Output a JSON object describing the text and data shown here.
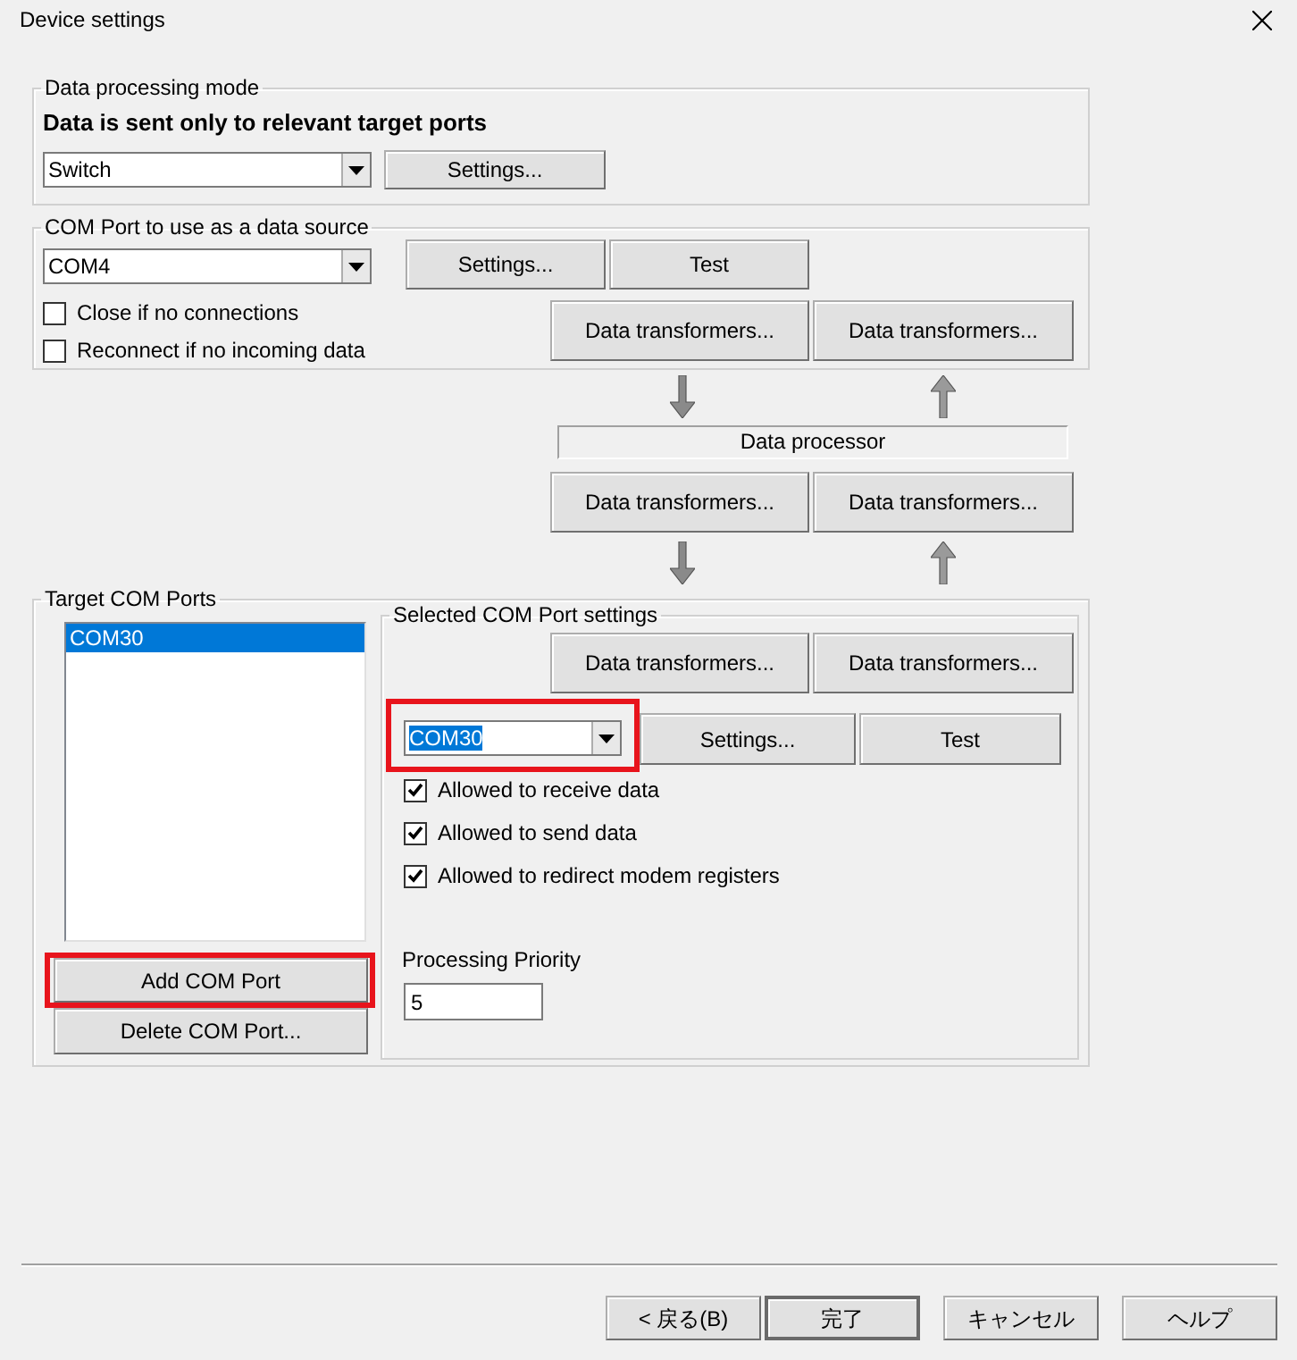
{
  "window": {
    "title": "Device settings"
  },
  "processing_mode": {
    "legend": "Data processing mode",
    "description": "Data is sent only to relevant target ports",
    "mode": {
      "value": "Switch",
      "text_selected": false
    },
    "settings_button": "Settings..."
  },
  "data_source": {
    "legend": "COM Port to use as a data source",
    "port": {
      "value": "COM4",
      "text_selected": false
    },
    "buttons": [
      "Settings...",
      "Test"
    ],
    "options": [
      {
        "label": "Close if no connections",
        "checked": false
      },
      {
        "label": "Reconnect if no incoming data",
        "checked": false
      }
    ],
    "transformer_buttons": [
      "Data transformers...",
      "Data transformers..."
    ]
  },
  "processor": {
    "label": "Data processor",
    "transformer_buttons": [
      "Data transformers...",
      "Data transformers..."
    ]
  },
  "target_ports": {
    "legend": "Target COM Ports",
    "items": [
      {
        "label": "COM30",
        "selected": true
      }
    ],
    "add_button": {
      "label": "Add COM Port",
      "highlighted": true
    },
    "delete_button": {
      "label": "Delete COM Port...",
      "highlighted": false
    }
  },
  "selected_port": {
    "legend": "Selected COM Port settings",
    "transformer_buttons": [
      "Data transformers...",
      "Data transformers..."
    ],
    "port": {
      "value": "COM30",
      "text_selected": true,
      "highlighted": true
    },
    "buttons": [
      "Settings...",
      "Test"
    ],
    "options": [
      {
        "label": "Allowed to receive data",
        "checked": true
      },
      {
        "label": "Allowed to send data",
        "checked": true
      },
      {
        "label": "Allowed to redirect modem registers",
        "checked": true
      }
    ],
    "priority_label": "Processing Priority",
    "priority": "5"
  },
  "footer_buttons": [
    {
      "label": "< 戻る(B)",
      "default": false
    },
    {
      "label": "完了",
      "default": true
    },
    {
      "label": "キャンセル",
      "default": false
    },
    {
      "label": "ヘルプ",
      "default": false
    }
  ]
}
